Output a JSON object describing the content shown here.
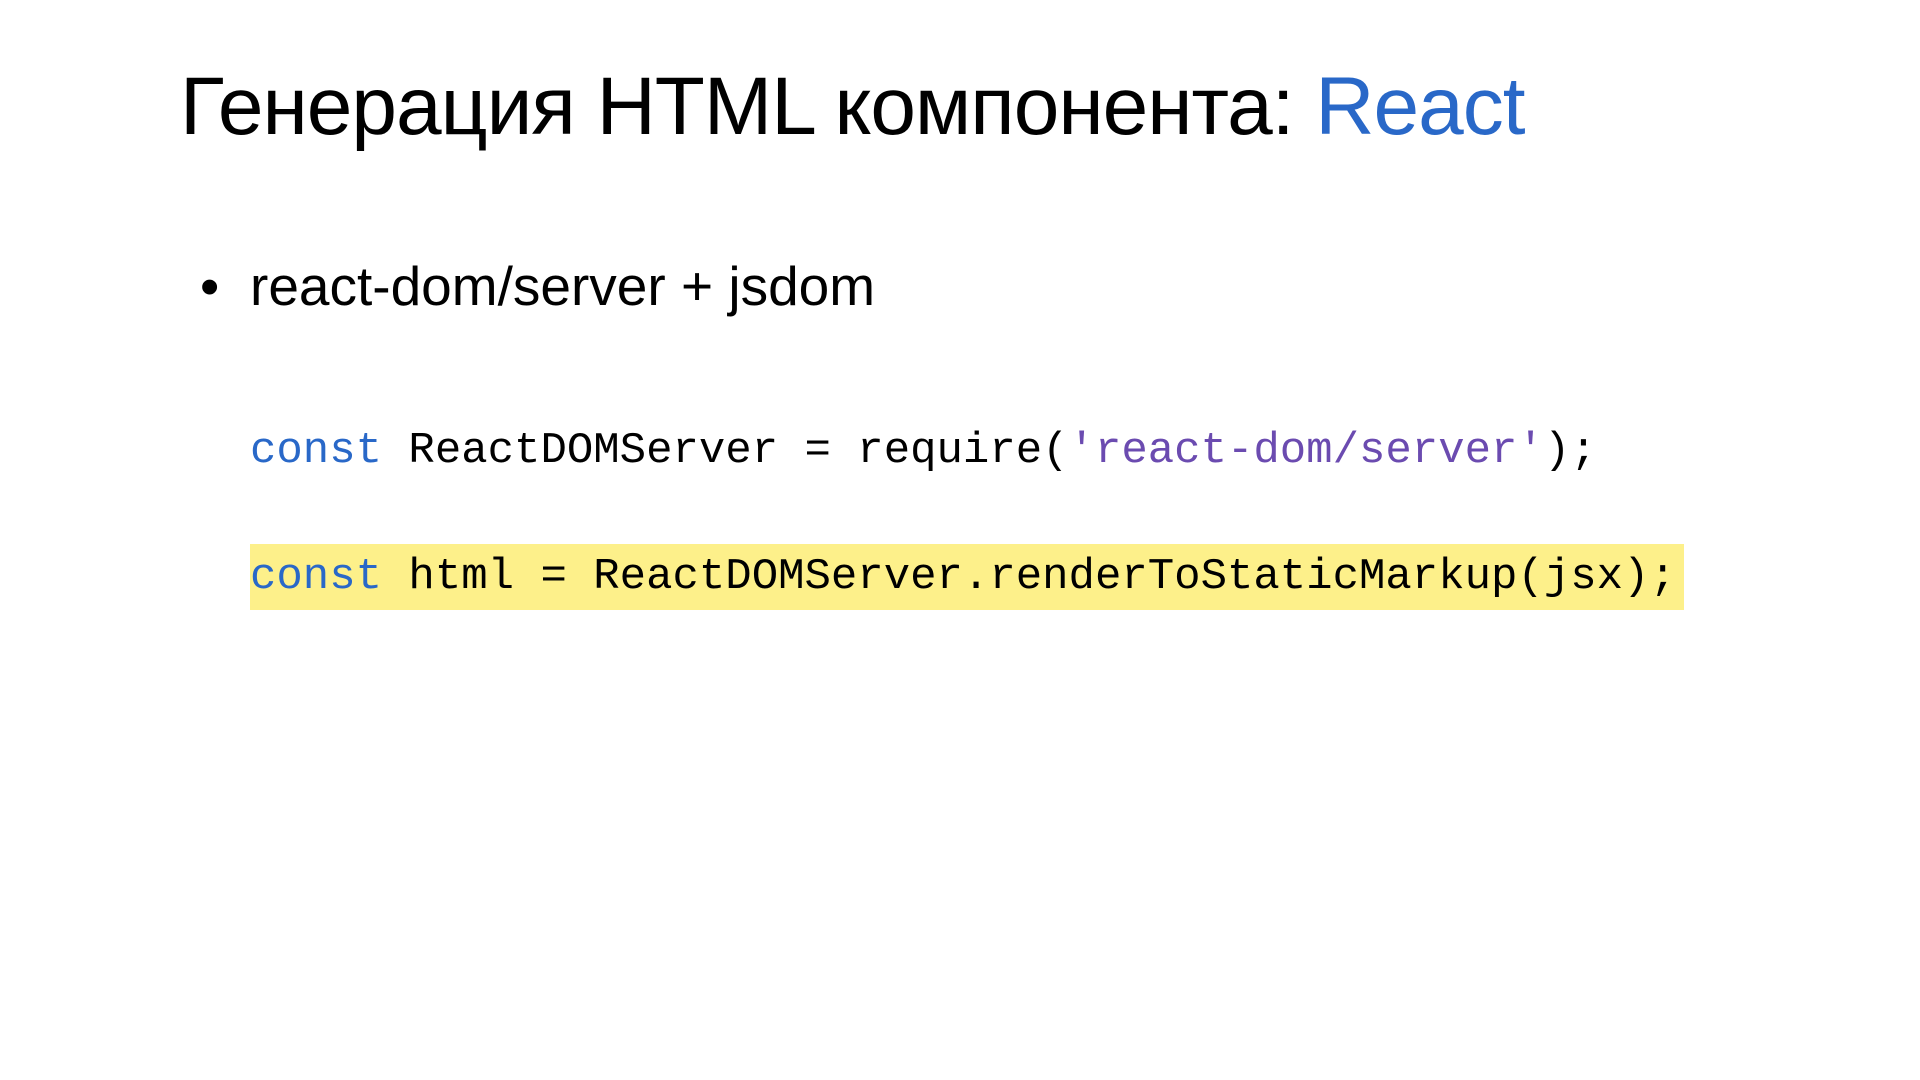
{
  "title": {
    "main": "Генерация HTML компонента: ",
    "accent": "React"
  },
  "bullet": "react-dom/server + jsdom",
  "code": {
    "line1": {
      "kw": "const",
      "rest1": " ReactDOMServer = require(",
      "str": "'react-dom/server'",
      "rest2": ");"
    },
    "line2": {
      "kw": "const",
      "rest": " html = ReactDOMServer.renderToStaticMarkup(jsx);"
    }
  }
}
